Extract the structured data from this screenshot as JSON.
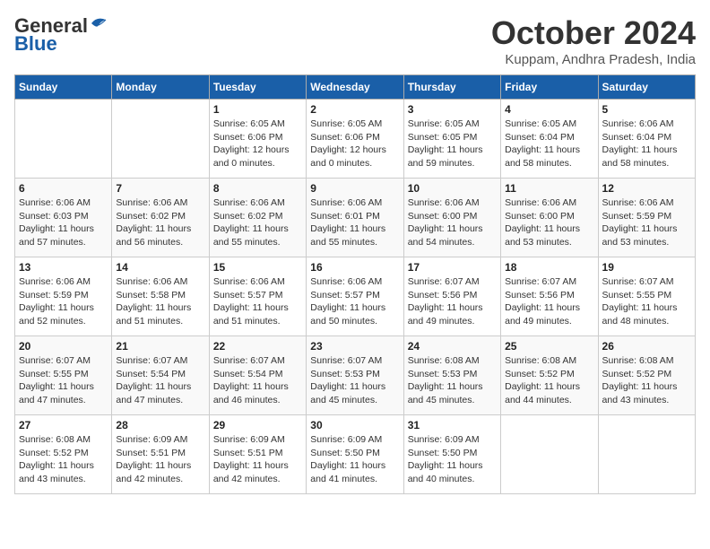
{
  "logo": {
    "general": "General",
    "blue": "Blue"
  },
  "title": "October 2024",
  "subtitle": "Kuppam, Andhra Pradesh, India",
  "days_header": [
    "Sunday",
    "Monday",
    "Tuesday",
    "Wednesday",
    "Thursday",
    "Friday",
    "Saturday"
  ],
  "weeks": [
    [
      {
        "day": "",
        "info": ""
      },
      {
        "day": "",
        "info": ""
      },
      {
        "day": "1",
        "info": "Sunrise: 6:05 AM\nSunset: 6:06 PM\nDaylight: 12 hours\nand 0 minutes."
      },
      {
        "day": "2",
        "info": "Sunrise: 6:05 AM\nSunset: 6:06 PM\nDaylight: 12 hours\nand 0 minutes."
      },
      {
        "day": "3",
        "info": "Sunrise: 6:05 AM\nSunset: 6:05 PM\nDaylight: 11 hours\nand 59 minutes."
      },
      {
        "day": "4",
        "info": "Sunrise: 6:05 AM\nSunset: 6:04 PM\nDaylight: 11 hours\nand 58 minutes."
      },
      {
        "day": "5",
        "info": "Sunrise: 6:06 AM\nSunset: 6:04 PM\nDaylight: 11 hours\nand 58 minutes."
      }
    ],
    [
      {
        "day": "6",
        "info": "Sunrise: 6:06 AM\nSunset: 6:03 PM\nDaylight: 11 hours\nand 57 minutes."
      },
      {
        "day": "7",
        "info": "Sunrise: 6:06 AM\nSunset: 6:02 PM\nDaylight: 11 hours\nand 56 minutes."
      },
      {
        "day": "8",
        "info": "Sunrise: 6:06 AM\nSunset: 6:02 PM\nDaylight: 11 hours\nand 55 minutes."
      },
      {
        "day": "9",
        "info": "Sunrise: 6:06 AM\nSunset: 6:01 PM\nDaylight: 11 hours\nand 55 minutes."
      },
      {
        "day": "10",
        "info": "Sunrise: 6:06 AM\nSunset: 6:00 PM\nDaylight: 11 hours\nand 54 minutes."
      },
      {
        "day": "11",
        "info": "Sunrise: 6:06 AM\nSunset: 6:00 PM\nDaylight: 11 hours\nand 53 minutes."
      },
      {
        "day": "12",
        "info": "Sunrise: 6:06 AM\nSunset: 5:59 PM\nDaylight: 11 hours\nand 53 minutes."
      }
    ],
    [
      {
        "day": "13",
        "info": "Sunrise: 6:06 AM\nSunset: 5:59 PM\nDaylight: 11 hours\nand 52 minutes."
      },
      {
        "day": "14",
        "info": "Sunrise: 6:06 AM\nSunset: 5:58 PM\nDaylight: 11 hours\nand 51 minutes."
      },
      {
        "day": "15",
        "info": "Sunrise: 6:06 AM\nSunset: 5:57 PM\nDaylight: 11 hours\nand 51 minutes."
      },
      {
        "day": "16",
        "info": "Sunrise: 6:06 AM\nSunset: 5:57 PM\nDaylight: 11 hours\nand 50 minutes."
      },
      {
        "day": "17",
        "info": "Sunrise: 6:07 AM\nSunset: 5:56 PM\nDaylight: 11 hours\nand 49 minutes."
      },
      {
        "day": "18",
        "info": "Sunrise: 6:07 AM\nSunset: 5:56 PM\nDaylight: 11 hours\nand 49 minutes."
      },
      {
        "day": "19",
        "info": "Sunrise: 6:07 AM\nSunset: 5:55 PM\nDaylight: 11 hours\nand 48 minutes."
      }
    ],
    [
      {
        "day": "20",
        "info": "Sunrise: 6:07 AM\nSunset: 5:55 PM\nDaylight: 11 hours\nand 47 minutes."
      },
      {
        "day": "21",
        "info": "Sunrise: 6:07 AM\nSunset: 5:54 PM\nDaylight: 11 hours\nand 47 minutes."
      },
      {
        "day": "22",
        "info": "Sunrise: 6:07 AM\nSunset: 5:54 PM\nDaylight: 11 hours\nand 46 minutes."
      },
      {
        "day": "23",
        "info": "Sunrise: 6:07 AM\nSunset: 5:53 PM\nDaylight: 11 hours\nand 45 minutes."
      },
      {
        "day": "24",
        "info": "Sunrise: 6:08 AM\nSunset: 5:53 PM\nDaylight: 11 hours\nand 45 minutes."
      },
      {
        "day": "25",
        "info": "Sunrise: 6:08 AM\nSunset: 5:52 PM\nDaylight: 11 hours\nand 44 minutes."
      },
      {
        "day": "26",
        "info": "Sunrise: 6:08 AM\nSunset: 5:52 PM\nDaylight: 11 hours\nand 43 minutes."
      }
    ],
    [
      {
        "day": "27",
        "info": "Sunrise: 6:08 AM\nSunset: 5:52 PM\nDaylight: 11 hours\nand 43 minutes."
      },
      {
        "day": "28",
        "info": "Sunrise: 6:09 AM\nSunset: 5:51 PM\nDaylight: 11 hours\nand 42 minutes."
      },
      {
        "day": "29",
        "info": "Sunrise: 6:09 AM\nSunset: 5:51 PM\nDaylight: 11 hours\nand 42 minutes."
      },
      {
        "day": "30",
        "info": "Sunrise: 6:09 AM\nSunset: 5:50 PM\nDaylight: 11 hours\nand 41 minutes."
      },
      {
        "day": "31",
        "info": "Sunrise: 6:09 AM\nSunset: 5:50 PM\nDaylight: 11 hours\nand 40 minutes."
      },
      {
        "day": "",
        "info": ""
      },
      {
        "day": "",
        "info": ""
      }
    ]
  ]
}
